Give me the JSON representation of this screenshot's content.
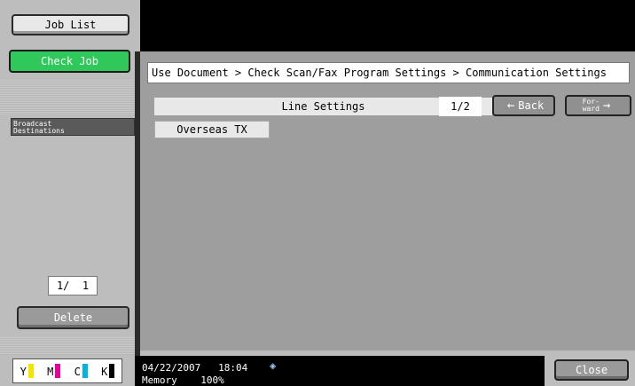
{
  "left_panel": {
    "job_list_label": "Job List",
    "check_job_label": "Check Job",
    "broadcast_label_line1": "Broadcast",
    "broadcast_label_line2": "Destinations",
    "pager": "1/  1",
    "delete_label": "Delete",
    "toner": [
      {
        "letter": "Y",
        "color": "#f2e600"
      },
      {
        "letter": "M",
        "color": "#e600a0"
      },
      {
        "letter": "C",
        "color": "#00b4e6"
      },
      {
        "letter": "K",
        "color": "#000000"
      }
    ]
  },
  "main": {
    "breadcrumb": "Use Document > Check Scan/Fax Program Settings > Communication Settings",
    "section_title": "Line Settings",
    "page_indicator": "1/2",
    "back_label": "Back",
    "forward_label_line1": "For-",
    "forward_label_line2": "ward",
    "items": [
      {
        "label": "Overseas TX"
      }
    ]
  },
  "status_bar": {
    "date": "04/22/2007",
    "time": "18:04",
    "memory_label": "Memory",
    "memory_value": "100%",
    "close_label": "Close"
  }
}
